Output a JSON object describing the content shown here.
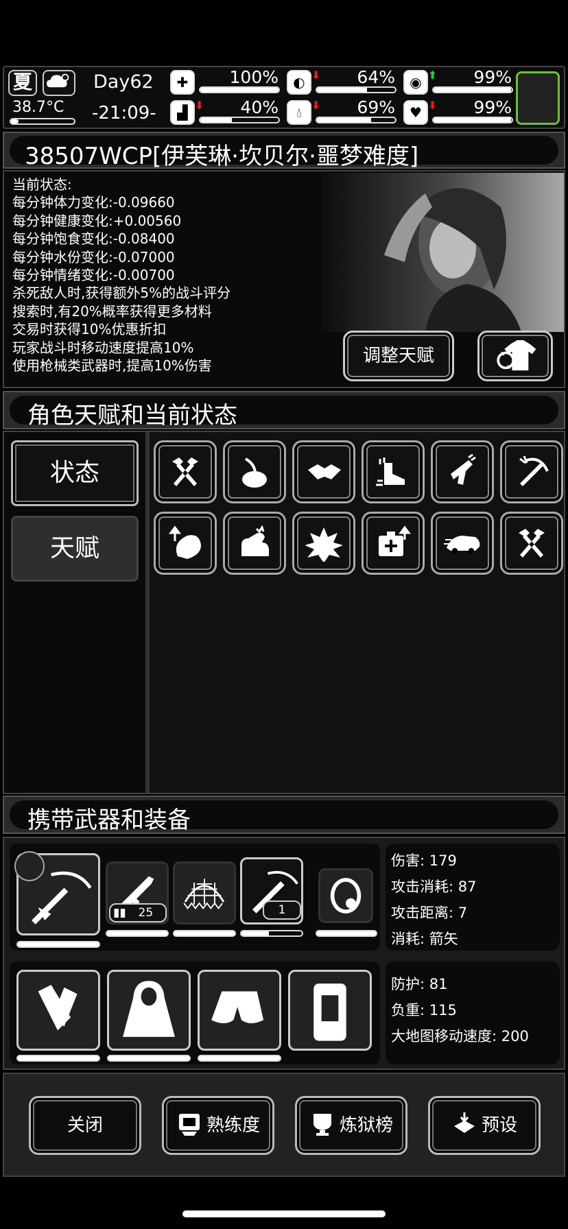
{
  "hud": {
    "season": "夏",
    "temperature": "38.7°C",
    "temperature_level": 0.12,
    "day": "Day62",
    "time": "-21:09-",
    "stats": [
      {
        "name": "health",
        "icon": "medkit-icon",
        "value": "100%",
        "level": 1.0,
        "arrow": ""
      },
      {
        "name": "hunger",
        "icon": "stomach-icon",
        "value": "64%",
        "level": 0.64,
        "arrow": "down",
        "arrow_color": "#e02020"
      },
      {
        "name": "mood",
        "icon": "pill-icon",
        "value": "99%",
        "level": 0.99,
        "arrow": "up",
        "arrow_color": "#2ecc40"
      },
      {
        "name": "stamina",
        "icon": "boot-icon",
        "value": "40%",
        "level": 0.4,
        "arrow": "down",
        "arrow_color": "#e02020"
      },
      {
        "name": "water",
        "icon": "water-drop-icon",
        "value": "69%",
        "level": 0.69,
        "arrow": "down",
        "arrow_color": "#e02020"
      },
      {
        "name": "emotion",
        "icon": "heart-icon",
        "value": "99%",
        "level": 0.99,
        "arrow": "down",
        "arrow_color": "#e02020"
      }
    ],
    "slot_border_color": "#6fbf3a"
  },
  "character_title": "38507WCP[伊芙琳·坎贝尔·噩梦难度]",
  "status": {
    "heading": "当前状态:",
    "lines": [
      "每分钟体力变化:-0.09660",
      "每分钟健康变化:+0.00560",
      "每分钟饱食变化:-0.08400",
      "每分钟水份变化:-0.07000",
      "每分钟情绪变化:-0.00700",
      "杀死敌人时,获得额外5%的战斗评分",
      "搜索时,有20%概率获得更多材料",
      "交易时获得10%优惠折扣",
      "玩家战斗时移动速度提高10%",
      "使用枪械类武器时,提高10%伤害"
    ],
    "adjust_talent_button": "调整天赋"
  },
  "talent_section_title": "角色天赋和当前状态",
  "tabs": {
    "status": "状态",
    "talent": "天赋"
  },
  "talents": [
    "crossed-axes-icon",
    "cooking-pot-icon",
    "handshake-icon",
    "speed-boot-icon",
    "pistol-icon",
    "crossbow-icon",
    "arm-up-icon",
    "muscle-flex-icon",
    "burst-icon",
    "medkit-plus-icon",
    "race-car-icon",
    "crossed-axes-icon"
  ],
  "equipment_section_title": "携带武器和装备",
  "weapons": {
    "ammo_rifle": "25",
    "ammo_crossbow": "1",
    "info": [
      {
        "label": "伤害",
        "value": "179"
      },
      {
        "label": "攻击消耗",
        "value": "87"
      },
      {
        "label": "攻击距离",
        "value": "7"
      },
      {
        "label": "消耗",
        "value": "箭矢"
      }
    ]
  },
  "armor": {
    "info": [
      {
        "label": "防护",
        "value": "81"
      },
      {
        "label": "负重",
        "value": "115"
      },
      {
        "label": "大地图移动速度",
        "value": "200"
      }
    ]
  },
  "bottom_buttons": {
    "close": "关闭",
    "proficiency": "熟练度",
    "hell_rank": "炼狱榜",
    "preset": "预设"
  }
}
